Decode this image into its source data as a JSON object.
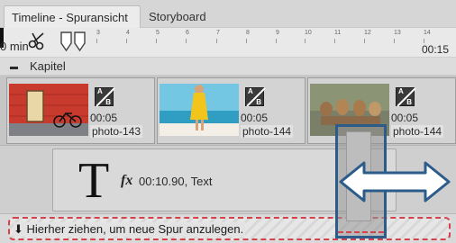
{
  "tabs": [
    {
      "label": "Timeline - Spuransicht",
      "active": true
    },
    {
      "label": "Storyboard",
      "active": false
    }
  ],
  "ruler": {
    "left_label": "0 min",
    "right_label": "00:15",
    "ticks": [
      "3",
      "4",
      "5",
      "6",
      "7",
      "8",
      "9",
      "10",
      "11",
      "12",
      "13",
      "14"
    ]
  },
  "chapter": {
    "label": "Kapitel"
  },
  "photo_clips": [
    {
      "time": "00:05",
      "name": "photo-143"
    },
    {
      "time": "00:05",
      "name": "photo-144"
    },
    {
      "time": "00:05",
      "name": "photo-144"
    }
  ],
  "text_clip": {
    "label": "00:10.90, Text",
    "glyph": "T",
    "fx": "fx"
  },
  "drop_zone": {
    "text": "Hierher ziehen, um neue Spur anzulegen."
  },
  "colors": {
    "accent_blue": "#2c5c8a",
    "drop_red": "#d4434b"
  }
}
